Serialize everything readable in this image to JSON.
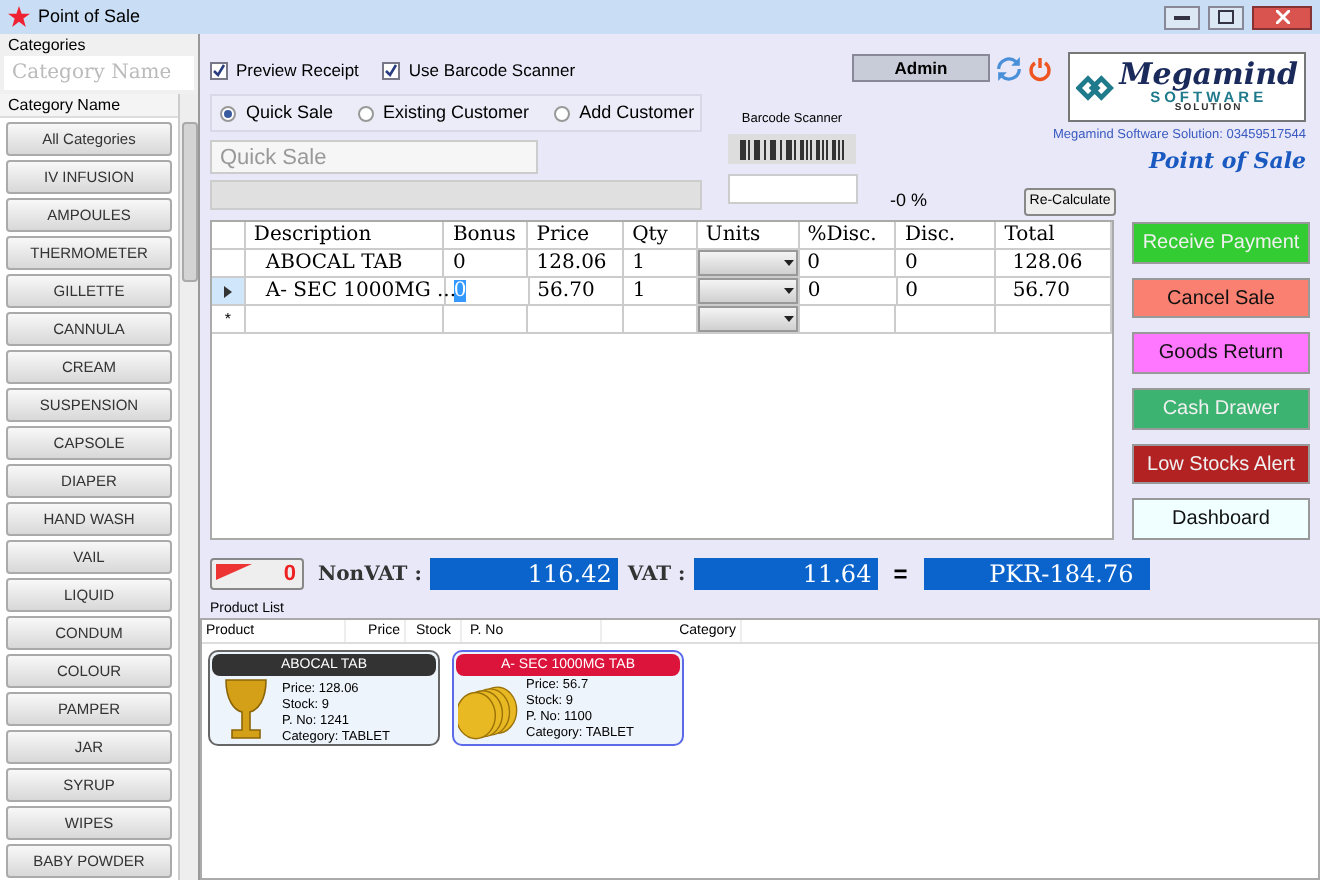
{
  "window": {
    "title": "Point of Sale"
  },
  "categories": {
    "label": "Categories",
    "search_placeholder": "Category Name",
    "column": "Category Name",
    "items": [
      "All Categories",
      "IV INFUSION",
      "AMPOULES",
      "THERMOMETER",
      "GILLETTE",
      "CANNULA",
      "CREAM",
      "SUSPENSION",
      "CAPSOLE",
      "DIAPER",
      "HAND WASH",
      "VAIL",
      "LIQUID",
      "CONDUM",
      "COLOUR",
      "PAMPER",
      "JAR",
      "SYRUP",
      "WIPES",
      "BABY POWDER"
    ]
  },
  "options": [
    {
      "label": "Preview Receipt",
      "checked": true
    },
    {
      "label": "Use Barcode Scanner",
      "checked": true
    }
  ],
  "customer_types": [
    {
      "label": "Quick Sale",
      "selected": true
    },
    {
      "label": "Existing Customer",
      "selected": false
    },
    {
      "label": "Add Customer",
      "selected": false
    }
  ],
  "customer_field": {
    "placeholder": "Quick Sale"
  },
  "barcode": {
    "label": "Barcode Scanner"
  },
  "discount_percent": "-0 %",
  "recalculate": "Re-Calculate",
  "user": "Admin",
  "brand": {
    "name": "Megamind",
    "line1": "SOFTWARE",
    "line2": "SOLUTION",
    "contact": "Megamind Software Solution:  03459517544",
    "product": "Point of Sale"
  },
  "grid": {
    "columns": [
      "Description",
      "Bonus",
      "Price",
      "Qty",
      "Units",
      "%Disc.",
      "Disc.",
      "Total"
    ],
    "rows": [
      {
        "description": "ABOCAL  TAB",
        "bonus": "0",
        "price": "128.06",
        "qty": "1",
        "disc_pct": "0",
        "disc": "0",
        "total": "128.06",
        "selected": false
      },
      {
        "description": "A- SEC 1000MG ...",
        "bonus": "0",
        "price": "56.70",
        "qty": "1",
        "disc_pct": "0",
        "disc": "0",
        "total": "56.70",
        "selected": true
      }
    ],
    "new_row_marker": "*"
  },
  "actions": [
    {
      "label": "Receive Payment",
      "color": "#33cc33"
    },
    {
      "label": "Cancel Sale",
      "color": "#fa8072"
    },
    {
      "label": "Goods Return",
      "color": "#ff77ff"
    },
    {
      "label": "Cash Drawer",
      "color": "#3cb371"
    },
    {
      "label": "Low Stocks Alert",
      "color": "#b22222"
    },
    {
      "label": "Dashboard",
      "color": "#f0ffff"
    }
  ],
  "totals": {
    "count": "0",
    "nonvat_label": "NonVAT :",
    "nonvat": "116.42",
    "vat_label": "VAT :",
    "vat": "11.64",
    "equals": "=",
    "grand": "PKR-184.76"
  },
  "products": {
    "label": "Product List",
    "columns": [
      "Product",
      "Price",
      "Stock",
      "P. No",
      "Category"
    ],
    "items": [
      {
        "name": "ABOCAL  TAB",
        "price": "Price: 128.06",
        "stock": "Stock: 9",
        "pno": "P. No: 1241",
        "category": "Category: TABLET",
        "color": "#333333",
        "kind": "goblet",
        "selected": false
      },
      {
        "name": "A- SEC 1000MG TAB",
        "price": "Price: 56.7",
        "stock": "Stock: 9",
        "pno": "P. No: 1100",
        "category": "Category: TABLET",
        "color": "#dc143c",
        "kind": "coins",
        "selected": true
      }
    ]
  }
}
